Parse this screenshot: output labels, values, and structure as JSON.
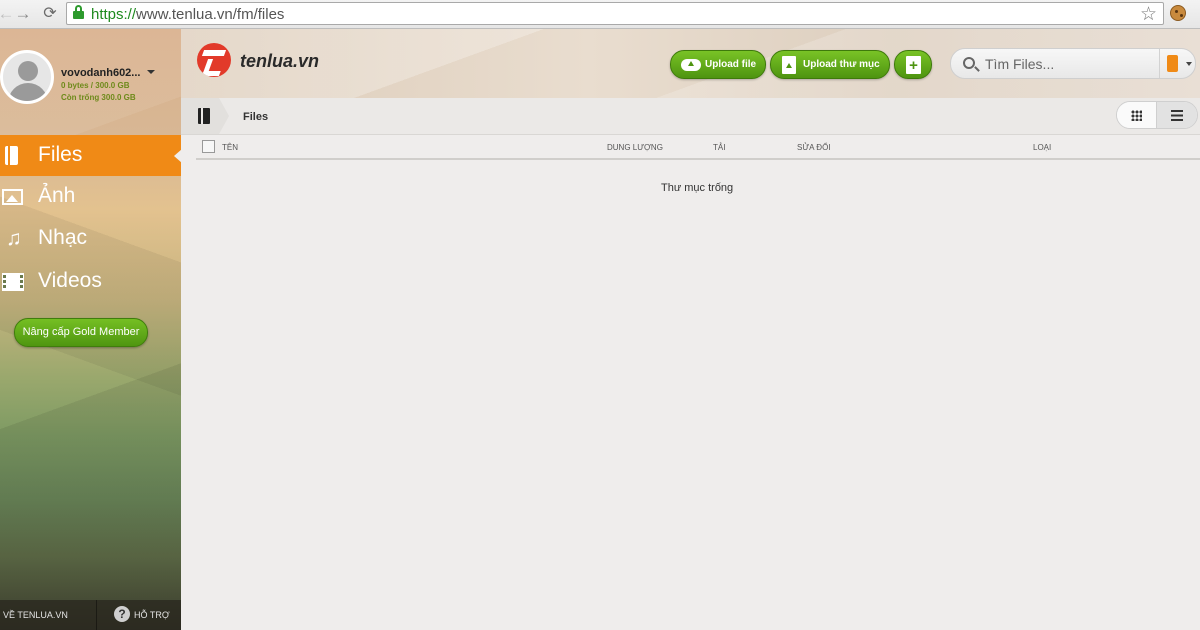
{
  "browser": {
    "url_scheme": "https://",
    "url_rest": "www.tenlua.vn/fm/files"
  },
  "user": {
    "name": "vovodanh602...",
    "quota": "0 bytes / 300.0 GB",
    "free": "Còn trống 300.0 GB"
  },
  "sidebar": {
    "items": [
      {
        "label": "Files",
        "icon": "file-icon",
        "active": true
      },
      {
        "label": "Ảnh",
        "icon": "photo-icon",
        "active": false
      },
      {
        "label": "Nhạc",
        "icon": "music-icon",
        "active": false
      },
      {
        "label": "Videos",
        "icon": "film-icon",
        "active": false
      }
    ],
    "upgrade_label": "Nâng cấp Gold Member",
    "footer": {
      "about_label": "VỀ TENLUA.VN",
      "help_label": "HỖ TRỢ",
      "help_glyph": "?"
    }
  },
  "header": {
    "logo_text": "tenlua.vn",
    "upload_file_label": "Upload file",
    "upload_folder_label": "Upload thư mục",
    "new_folder_glyph": "+",
    "search_placeholder": "Tìm Files..."
  },
  "breadcrumb": {
    "current": "Files"
  },
  "table": {
    "columns": [
      "TÊN",
      "DUNG LƯỢNG",
      "TẢI",
      "SỬA ĐỔI",
      "LOẠI"
    ],
    "empty_message": "Thư mục trống"
  },
  "colors": {
    "accent_orange": "#f08a16",
    "button_green": "#5ea818",
    "logo_red": "#e23a2a"
  }
}
